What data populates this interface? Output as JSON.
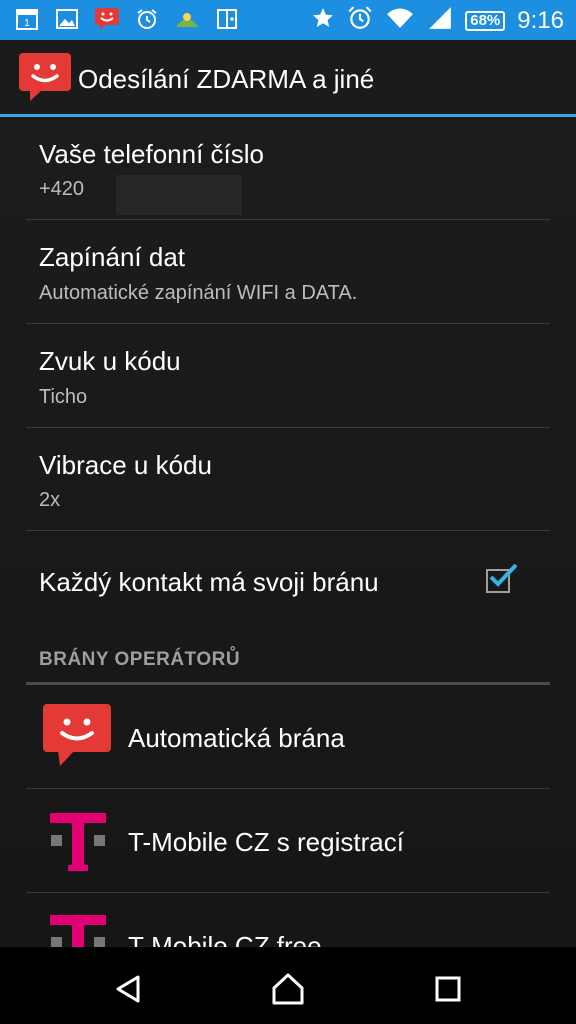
{
  "status_bar": {
    "battery": "68%",
    "time": "9:16",
    "icons": [
      "calendar-icon",
      "gallery-icon",
      "app-notification-icon",
      "alarm-clock-app-icon",
      "weather-icon",
      "book-icon",
      "star-icon",
      "alarm-icon",
      "wifi-icon",
      "signal-icon"
    ]
  },
  "app": {
    "title": "Odesílání ZDARMA a jiné",
    "accent": "#e53935",
    "statusbar_color": "#1c8fe0"
  },
  "settings": [
    {
      "title": "Vaše telefonní číslo",
      "summary": "+420"
    },
    {
      "title": "Zapínání dat",
      "summary": "Automatické zapínání WIFI a DATA."
    },
    {
      "title": "Zvuk u kódu",
      "summary": "Ticho"
    },
    {
      "title": "Vibrace u kódu",
      "summary": "2x"
    },
    {
      "title": "Každý kontakt má svoji bránu",
      "checked": true
    }
  ],
  "section": {
    "header": "BRÁNY OPERÁTORŮ"
  },
  "gateways": [
    {
      "label": "Automatická brána",
      "icon": "smiley-message-icon"
    },
    {
      "label": "T-Mobile CZ s registrací",
      "icon": "t-mobile-logo-icon"
    },
    {
      "label": "T-Mobile CZ free",
      "icon": "t-mobile-logo-icon"
    }
  ],
  "navigation": [
    "back-icon",
    "home-icon",
    "recents-icon"
  ]
}
